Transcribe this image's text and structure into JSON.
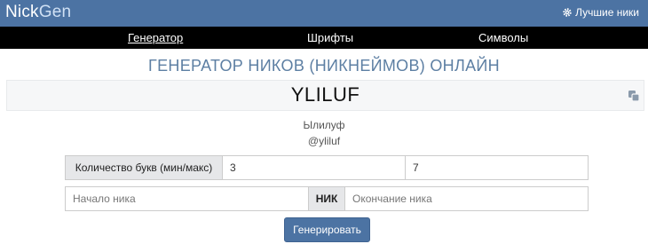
{
  "header": {
    "logo_part1": "Nick",
    "logo_part2": "Gen",
    "best_nicks_label": "Лучшие ники"
  },
  "nav": {
    "items": [
      {
        "label": "Генератор",
        "active": true
      },
      {
        "label": "Шрифты",
        "active": false
      },
      {
        "label": "Символы",
        "active": false
      }
    ]
  },
  "page_title": "ГЕНЕРАТОР НИКОВ (НИКНЕЙМОВ) ОНЛАЙН",
  "result": {
    "nick": "YLILUF",
    "transliteration": "Ылилуф",
    "handle": "@yliluf"
  },
  "letters": {
    "label": "Количество букв (мин/макс)",
    "min": "3",
    "max": "7"
  },
  "affix": {
    "start_placeholder": "Начало ника",
    "middle_label": "НИК",
    "end_placeholder": "Окончание ника"
  },
  "generate_label": "Генерировать",
  "colors": {
    "brand": "#4c73a3",
    "title": "#5d7fa3"
  }
}
